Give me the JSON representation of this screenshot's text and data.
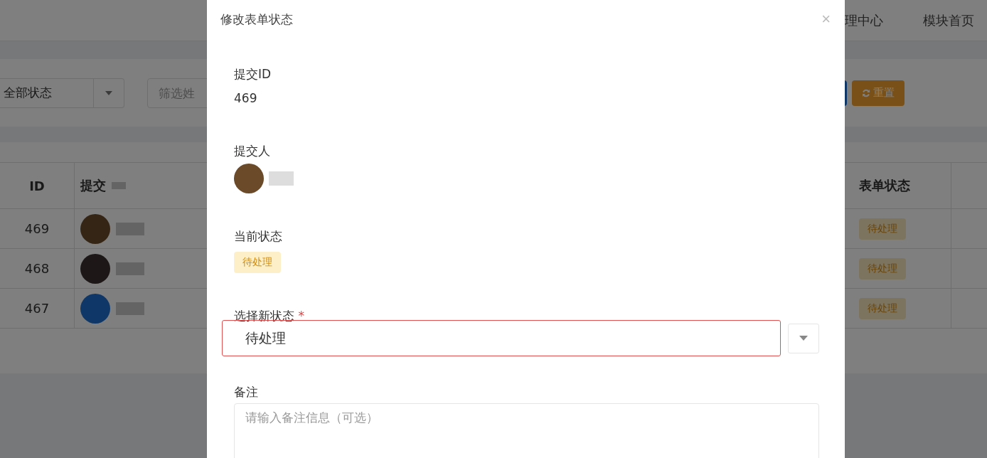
{
  "header_nav": [
    "理中心",
    "模块首页"
  ],
  "filters": {
    "status_select": "全部状态",
    "name_search_placeholder": "筛选姓",
    "reset_button": "重置"
  },
  "table": {
    "columns": [
      "ID",
      "提交",
      "表单状态"
    ],
    "rows": [
      {
        "id": "469",
        "status": "待处理"
      },
      {
        "id": "468",
        "status": "待处理"
      },
      {
        "id": "467",
        "status": "待处理"
      }
    ]
  },
  "modal": {
    "title": "修改表单状态",
    "close": "×",
    "submission_id_label": "提交ID",
    "submission_id": "469",
    "submitter_label": "提交人",
    "current_status_label": "当前状态",
    "current_status": "待处理",
    "new_status_label": "选择新状态",
    "required_mark": "*",
    "new_status": "待处理",
    "note_label": "备注",
    "note_placeholder": "请输入备注信息（可选）"
  }
}
